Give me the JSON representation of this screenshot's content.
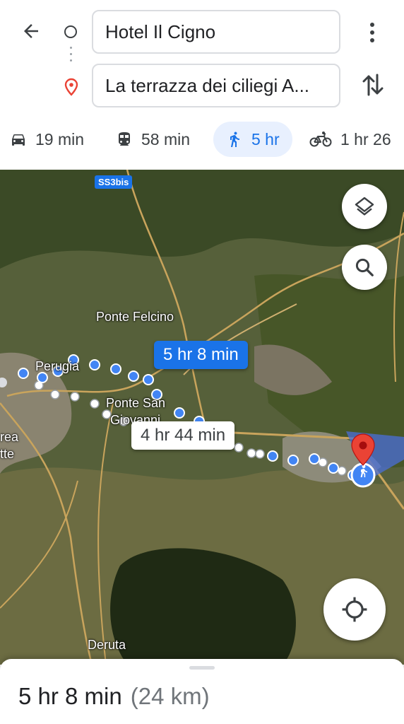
{
  "header": {
    "origin_value": "Hotel Il Cigno",
    "destination_value": "La terrazza dei ciliegi A..."
  },
  "modes": [
    {
      "icon": "car-icon",
      "label": "19 min",
      "active": false
    },
    {
      "icon": "train-icon",
      "label": "58 min",
      "active": false
    },
    {
      "icon": "walk-icon",
      "label": "5 hr",
      "active": true
    },
    {
      "icon": "bike-icon",
      "label": "1 hr 26",
      "active": false
    }
  ],
  "map": {
    "road_shield": "SS3bis",
    "places": {
      "ponte_felcino": "Ponte Felcino",
      "perugia": "Perugia",
      "ponte_san": "Ponte San",
      "giovanni_partial": "Giovanni",
      "rea_partial": "rea",
      "tte_partial": "tte",
      "deruta": "Deruta"
    },
    "primary_route_label": "5 hr 8 min",
    "alternate_route_label": "4 hr 44 min"
  },
  "summary": {
    "duration": "5 hr 8 min",
    "distance": "(24 km)"
  },
  "colors": {
    "accent": "#1a73e8",
    "active_mode_bg": "#e8f0fe",
    "destination_pin": "#ea4335"
  }
}
